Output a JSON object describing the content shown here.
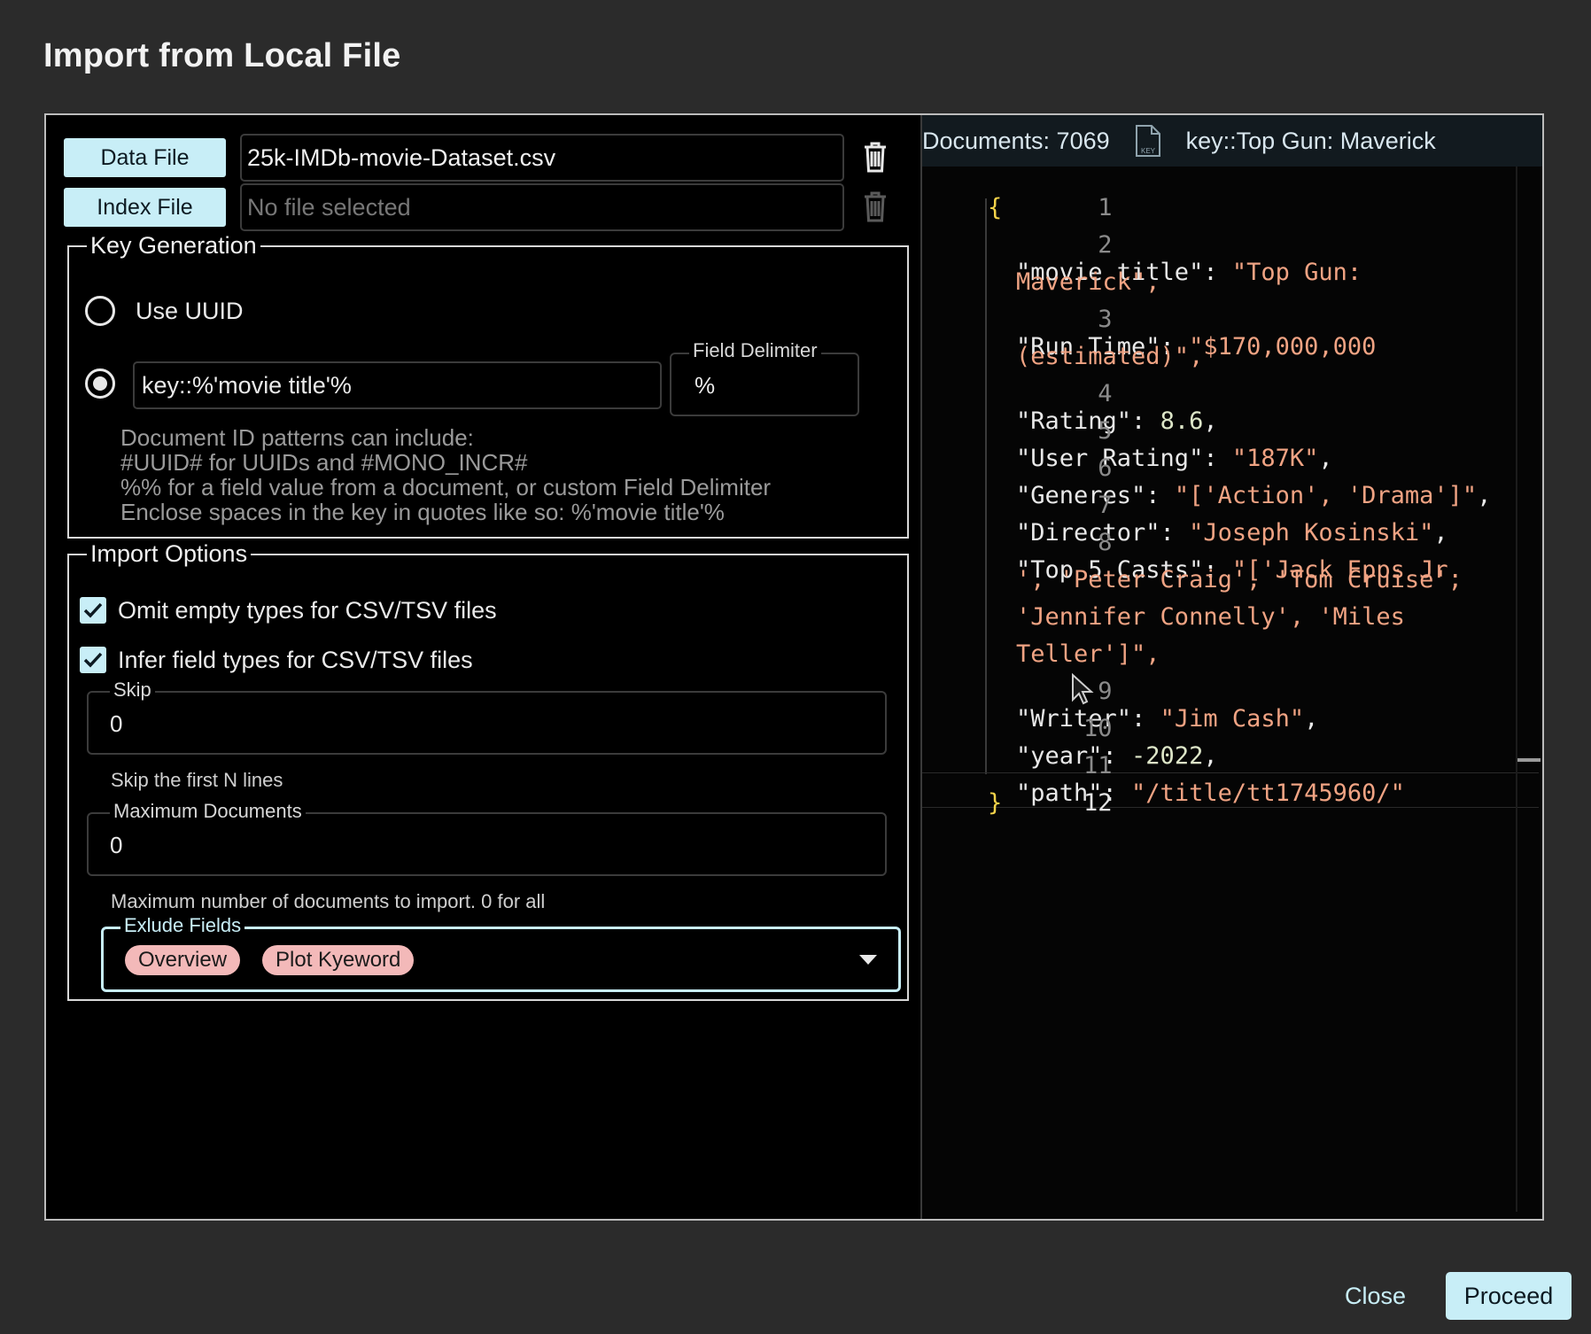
{
  "dialog": {
    "title": "Import from Local File"
  },
  "files": {
    "data_file": {
      "button_label": "Data File",
      "value": "25k-IMDb-movie-Dataset.csv"
    },
    "index_file": {
      "button_label": "Index File",
      "placeholder": "No file selected"
    },
    "icons": [
      "trash-icon"
    ]
  },
  "key_generation": {
    "legend": "Key Generation",
    "use_uuid_label": "Use UUID",
    "selected_option": "pattern",
    "pattern_value": "key::%'movie title'%",
    "field_delimiter": {
      "label": "Field Delimiter",
      "value": "%"
    },
    "help_lines": [
      "Document ID patterns can include:",
      "#UUID# for UUIDs and #MONO_INCR#",
      "%% for a field value from a document, or custom Field Delimiter",
      "Enclose spaces in the key in quotes like so: %'movie title'%"
    ]
  },
  "import_options": {
    "legend": "Import Options",
    "omit_empty": {
      "label": "Omit empty types for CSV/TSV files",
      "checked": true
    },
    "infer_types": {
      "label": "Infer field types for CSV/TSV files",
      "checked": true
    },
    "skip": {
      "label": "Skip",
      "value": "0",
      "helper": "Skip the first N lines"
    },
    "max_docs": {
      "label": "Maximum Documents",
      "value": "0",
      "helper": "Maximum number of documents to import. 0 for all"
    },
    "exclude_fields": {
      "label": "Exlude Fields",
      "chips": [
        "Overview",
        "Plot Kyeword"
      ]
    }
  },
  "preview": {
    "documents_label": "Documents: 7069",
    "key_label": "key::Top Gun: Maverick",
    "key_icon_text": "KEY",
    "lines": [
      {
        "n": "1",
        "text": "{"
      },
      {
        "n": "2",
        "text": "\"movie title\": \"Top Gun:",
        "cont": "Maverick\","
      },
      {
        "n": "3",
        "text": "\"Run Time\": \"$170,000,000",
        "cont": "(estimated)\","
      },
      {
        "n": "4",
        "text": "\"Rating\": 8.6,"
      },
      {
        "n": "5",
        "text": "\"User Rating\": \"187K\","
      },
      {
        "n": "6",
        "text": "\"Generes\": \"['Action', 'Drama']\","
      },
      {
        "n": "7",
        "text": "\"Director\": \"Joseph Kosinski\","
      },
      {
        "n": "8",
        "text": "\"Top 5 Casts\": \"['Jack Epps Jr.",
        "cont": "', 'Peter Craig', 'Tom Cruise',",
        "cont2": "'Jennifer Connelly', 'Miles",
        "cont3": "Teller']\","
      },
      {
        "n": "9",
        "text": "\"Writer\": \"Jim Cash\","
      },
      {
        "n": "10",
        "text": "\"year\": -2022,"
      },
      {
        "n": "11",
        "text": "\"path\": \"/title/tt1745960/\""
      },
      {
        "n": "12",
        "text": "}"
      }
    ]
  },
  "footer": {
    "close_label": "Close",
    "proceed_label": "Proceed"
  },
  "colors": {
    "accent": "#c8eef7",
    "chip": "#f3b9b9",
    "string": "#f0a383",
    "brace": "#f3d34a"
  }
}
